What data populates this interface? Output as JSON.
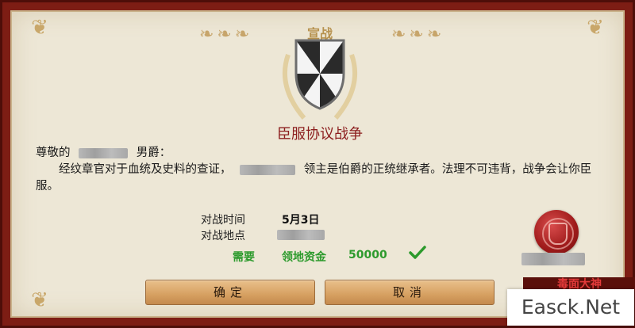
{
  "dialog": {
    "title": "宣战",
    "subtitle": "臣服协议战争",
    "letter": {
      "greeting_prefix": "尊敬的",
      "greeting_suffix": "男爵：",
      "body_part1": "经纹章官对于血统及史料的查证，",
      "body_part2": "领主是伯爵的正统继承者。法理不可违背，战争会让你臣服。"
    },
    "battle_time_label": "对战时间",
    "battle_time_value": "5月3日",
    "battle_place_label": "对战地点",
    "requirement": {
      "need_label": "需要",
      "resource_label": "领地资金",
      "amount": "50000",
      "status_icon": "check-icon"
    },
    "confirm_button": "确定",
    "cancel_button": "取消"
  },
  "overlay_text": "毒面大神",
  "watermark": "Easck.Net",
  "colors": {
    "frame": "#7d1d14",
    "paper": "#ede7d6",
    "accent_red": "#8c1e1e",
    "requirement_green": "#2c9a2c",
    "button": "#d6a061"
  }
}
